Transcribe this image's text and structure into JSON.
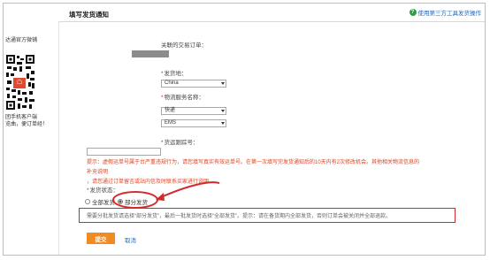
{
  "header": {
    "title": "填写发货通知",
    "help_link": "使用第三方工具发货操作"
  },
  "sidebar": {
    "promo_top": "达通官方微铺",
    "promo_bottom_line1": "团手机客户端",
    "promo_bottom_line2": "览曲，便订单经！"
  },
  "form": {
    "order_label": "关联的交易订单：",
    "origin_label": "发货地：",
    "origin_value": "China",
    "logistics_label": "物流服务名称：",
    "logistics_value_1": "快递",
    "logistics_value_2": "EMS",
    "tracking_label": "货运跟踪号：",
    "tracking_value": "",
    "tip_line_1": "提示：虚假运单号属于台严重违规行为，请您填写真实有效运单号。在第一次填写完发货通知后的10天内有2次修改机会。其他相关物流信息的补充说明",
    "tip_line_2": "，请您通过订单留言或站内信及时联系买家进行说明。",
    "status_label": "发货状态：",
    "status_full": "全部发货",
    "status_partial": "部分发货",
    "partial_note": "需要分批发货请选择“部分发货”，最后一批发货时选择“全部发货”。提示：请在备货期内全部发货，否则订单会被关闭并全部退款。",
    "submit_label": "提交",
    "cancel_label": "取消"
  },
  "colors": {
    "accent_orange": "#f38a1f",
    "link_blue": "#2266bb",
    "annotation_red": "#d12a2a",
    "tip_red": "#e0401f"
  }
}
